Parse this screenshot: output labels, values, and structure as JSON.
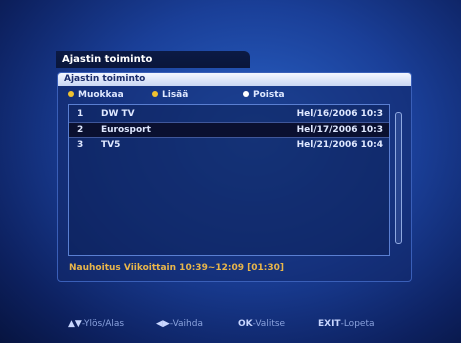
{
  "window": {
    "title": "Ajastin toiminto"
  },
  "panel": {
    "header": "Ajastin toiminto"
  },
  "legend": [
    {
      "label": "Muokkaa",
      "color": "#f0c230"
    },
    {
      "label": "Lisää",
      "color": "#f0c230"
    },
    {
      "label": "Poista",
      "color": "#ffffff"
    }
  ],
  "timers": [
    {
      "num": "1",
      "channel": "DW TV",
      "time": "Hel/16/2006 10:3"
    },
    {
      "num": "2",
      "channel": "Eurosport",
      "time": "Hel/17/2006 10:3"
    },
    {
      "num": "3",
      "channel": "TV5",
      "time": "Hel/21/2006 10:4"
    }
  ],
  "selected_index": 1,
  "info": "Nauhoitus  Viikoittain  10:39~12:09 [01:30]",
  "footer": [
    {
      "key": "▲▼",
      "text": "-Ylös/Alas"
    },
    {
      "key": "◀▶",
      "text": "-Vaihda"
    },
    {
      "key": "OK",
      "text": "-Valitse"
    },
    {
      "key": "EXIT",
      "text": "-Lopeta"
    }
  ],
  "colors": {
    "accent": "#e9b64a",
    "background": "#1a3f98"
  }
}
